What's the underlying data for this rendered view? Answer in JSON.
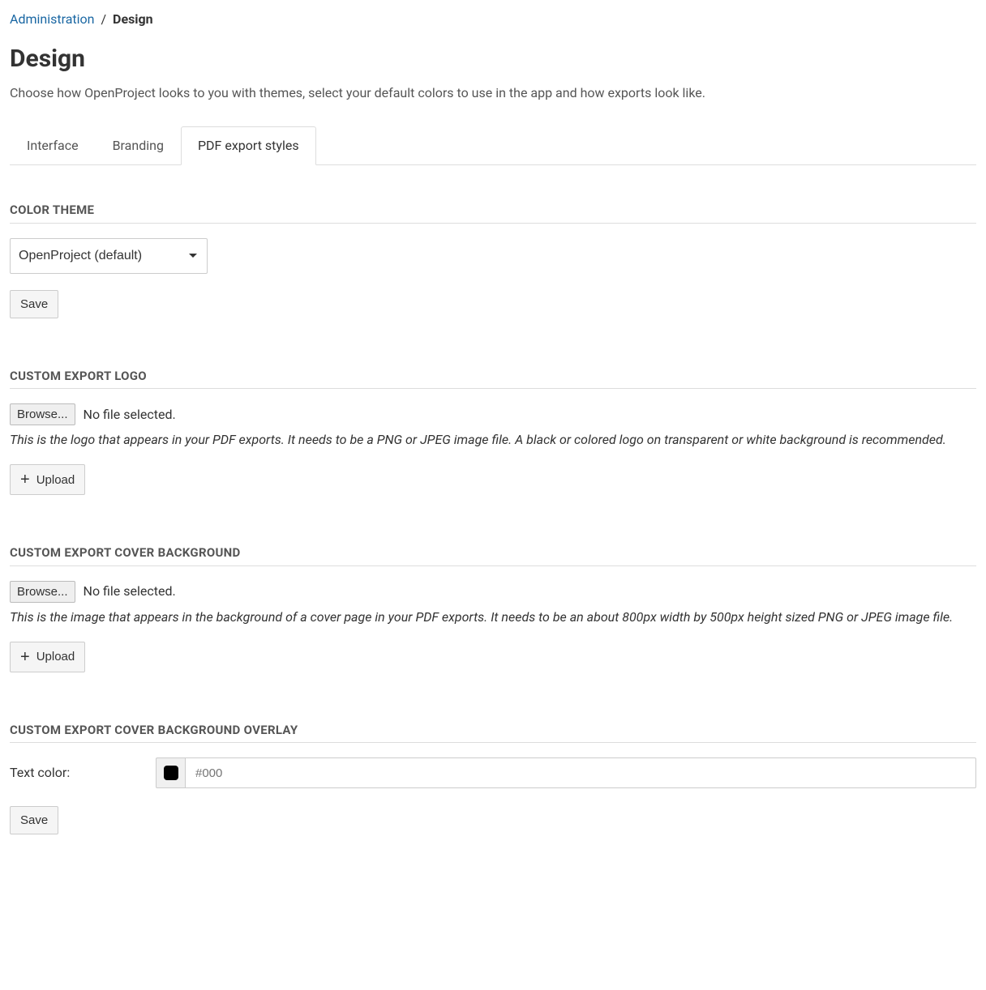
{
  "breadcrumb": {
    "parent": "Administration",
    "separator": "/",
    "current": "Design"
  },
  "page_title": "Design",
  "page_desc": "Choose how OpenProject looks to you with themes, select your default colors to use in the app and how exports look like.",
  "tabs": {
    "interface": "Interface",
    "branding": "Branding",
    "pdf_export": "PDF export styles"
  },
  "color_theme": {
    "heading": "COLOR THEME",
    "selected": "OpenProject (default)",
    "save_label": "Save"
  },
  "export_logo": {
    "heading": "CUSTOM EXPORT LOGO",
    "browse_label": "Browse...",
    "file_status": "No file selected.",
    "help": "This is the logo that appears in your PDF exports. It needs to be a PNG or JPEG image file. A black or colored logo on transparent or white background is recommended.",
    "upload_label": "Upload"
  },
  "cover_bg": {
    "heading": "CUSTOM EXPORT COVER BACKGROUND",
    "browse_label": "Browse...",
    "file_status": "No file selected.",
    "help": "This is the image that appears in the background of a cover page in your PDF exports. It needs to be an about 800px width by 500px height sized PNG or JPEG image file.",
    "upload_label": "Upload"
  },
  "cover_overlay": {
    "heading": "CUSTOM EXPORT COVER BACKGROUND OVERLAY",
    "text_color_label": "Text color:",
    "text_color_placeholder": "#000",
    "text_color_value": "",
    "swatch_color": "#000000",
    "save_label": "Save"
  }
}
